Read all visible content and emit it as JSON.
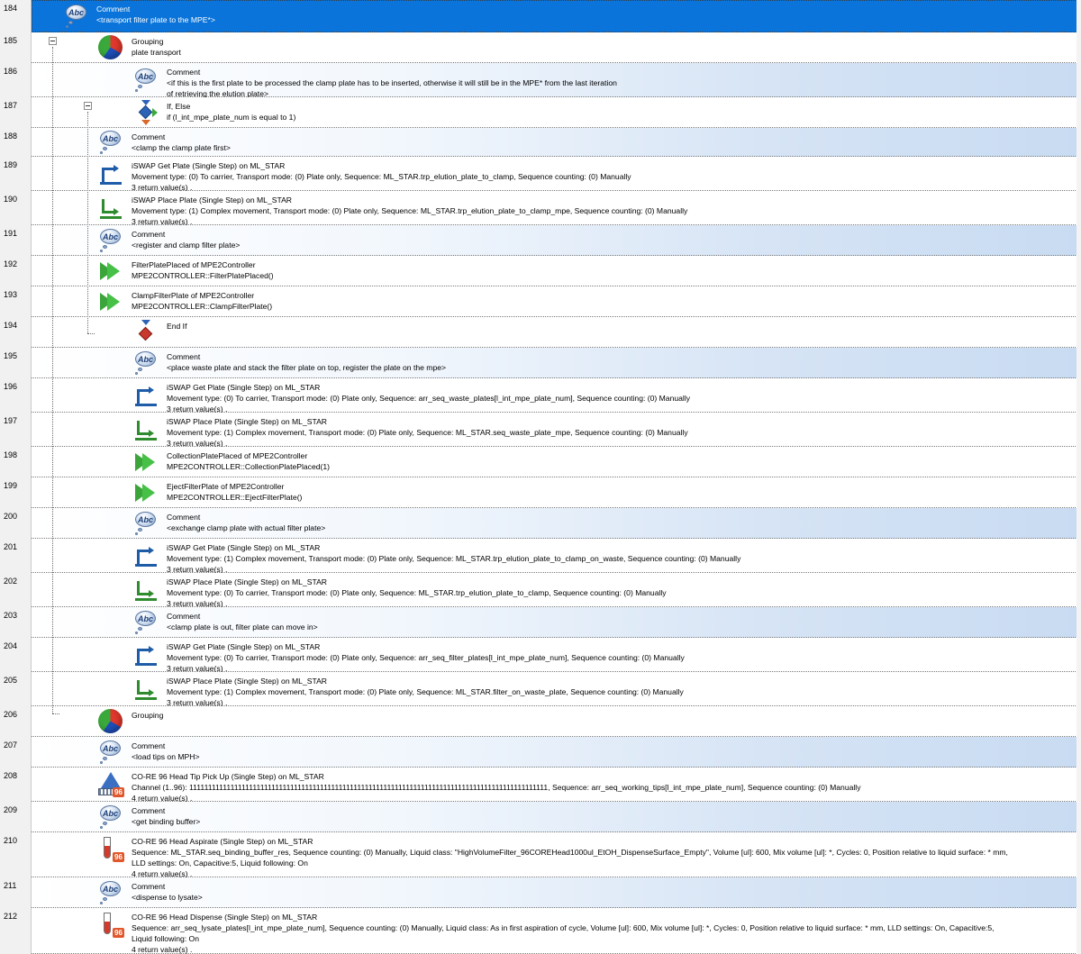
{
  "editor": {
    "rows": [
      {
        "num": "184",
        "kind": "comment",
        "icon": "comment-icon",
        "lines": [
          "Comment",
          "<transport filter plate to the MPE*>"
        ],
        "selected": true
      },
      {
        "num": "185",
        "kind": "group",
        "icon": "grouping-icon",
        "lines": [
          "Grouping",
          "plate transport"
        ]
      },
      {
        "num": "186",
        "kind": "comment",
        "icon": "comment-icon",
        "lines": [
          "Comment",
          "<if this is the first plate to be processed the clamp plate has to be inserted, otherwise it will still be in the MPE* from the last iteration",
          "of retrieving the elution plate>"
        ]
      },
      {
        "num": "187",
        "kind": "if",
        "icon": "if-else-icon",
        "lines": [
          "If, Else",
          "if (l_int_mpe_plate_num is equal to 1)"
        ]
      },
      {
        "num": "188",
        "kind": "comment",
        "icon": "comment-icon",
        "lines": [
          "Comment",
          "<clamp the clamp plate first>"
        ]
      },
      {
        "num": "189",
        "kind": "get",
        "icon": "iswap-get-plate-icon",
        "lines": [
          "iSWAP Get Plate (Single Step) on ML_STAR",
          "Movement type: (0) To carrier, Transport mode: (0) Plate only, Sequence: ML_STAR.trp_elution_plate_to_clamp, Sequence counting: (0) Manually",
          "3 return value(s) ."
        ]
      },
      {
        "num": "190",
        "kind": "place",
        "icon": "iswap-place-plate-icon",
        "lines": [
          "iSWAP Place Plate (Single Step) on ML_STAR",
          "Movement type: (1) Complex movement, Transport mode: (0) Plate only, Sequence: ML_STAR.trp_elution_plate_to_clamp_mpe, Sequence counting: (0) Manually",
          "3 return value(s) ."
        ]
      },
      {
        "num": "191",
        "kind": "comment",
        "icon": "comment-icon",
        "lines": [
          "Comment",
          "<register and clamp filter plate>"
        ]
      },
      {
        "num": "192",
        "kind": "play",
        "icon": "library-call-icon",
        "lines": [
          "FilterPlatePlaced of MPE2Controller",
          "MPE2CONTROLLER::FilterPlatePlaced()"
        ]
      },
      {
        "num": "193",
        "kind": "play",
        "icon": "library-call-icon",
        "lines": [
          "ClampFilterPlate of MPE2Controller",
          "MPE2CONTROLLER::ClampFilterPlate()"
        ]
      },
      {
        "num": "194",
        "kind": "endif",
        "icon": "end-if-icon",
        "lines": [
          "End If"
        ]
      },
      {
        "num": "195",
        "kind": "comment",
        "icon": "comment-icon",
        "lines": [
          "Comment",
          "<place waste plate and stack the filter plate on top, register the plate on the mpe>"
        ]
      },
      {
        "num": "196",
        "kind": "get",
        "icon": "iswap-get-plate-icon",
        "lines": [
          "iSWAP Get Plate (Single Step) on ML_STAR",
          "Movement type: (0) To carrier, Transport mode: (0) Plate only, Sequence: arr_seq_waste_plates[l_int_mpe_plate_num], Sequence counting: (0) Manually",
          "3 return value(s) ."
        ]
      },
      {
        "num": "197",
        "kind": "place",
        "icon": "iswap-place-plate-icon",
        "lines": [
          "iSWAP Place Plate (Single Step) on ML_STAR",
          "Movement type: (1) Complex movement, Transport mode: (0) Plate only, Sequence: ML_STAR.seq_waste_plate_mpe, Sequence counting: (0) Manually",
          "3 return value(s) ."
        ]
      },
      {
        "num": "198",
        "kind": "play",
        "icon": "library-call-icon",
        "lines": [
          "CollectionPlatePlaced of MPE2Controller",
          "MPE2CONTROLLER::CollectionPlatePlaced(1)"
        ]
      },
      {
        "num": "199",
        "kind": "play",
        "icon": "library-call-icon",
        "lines": [
          "EjectFilterPlate of MPE2Controller",
          "MPE2CONTROLLER::EjectFilterPlate()"
        ]
      },
      {
        "num": "200",
        "kind": "comment",
        "icon": "comment-icon",
        "lines": [
          "Comment",
          "<exchange clamp plate with actual filter plate>"
        ]
      },
      {
        "num": "201",
        "kind": "get",
        "icon": "iswap-get-plate-icon",
        "lines": [
          "iSWAP Get Plate (Single Step) on ML_STAR",
          "Movement type: (1) Complex movement, Transport mode: (0) Plate only, Sequence: ML_STAR.trp_elution_plate_to_clamp_on_waste, Sequence counting: (0) Manually",
          "3 return value(s) ."
        ]
      },
      {
        "num": "202",
        "kind": "place",
        "icon": "iswap-place-plate-icon",
        "lines": [
          "iSWAP Place Plate (Single Step) on ML_STAR",
          "Movement type: (0) To carrier, Transport mode: (0) Plate only, Sequence: ML_STAR.trp_elution_plate_to_clamp, Sequence counting: (0) Manually",
          "3 return value(s) ."
        ]
      },
      {
        "num": "203",
        "kind": "comment",
        "icon": "comment-icon",
        "lines": [
          "Comment",
          "<clamp plate is out, filter plate can move in>"
        ]
      },
      {
        "num": "204",
        "kind": "get",
        "icon": "iswap-get-plate-icon",
        "lines": [
          "iSWAP Get Plate (Single Step) on ML_STAR",
          "Movement type: (0) To carrier, Transport mode: (0) Plate only, Sequence: arr_seq_filter_plates[l_int_mpe_plate_num], Sequence counting: (0) Manually",
          "3 return value(s) ."
        ]
      },
      {
        "num": "205",
        "kind": "place",
        "icon": "iswap-place-plate-icon",
        "lines": [
          "iSWAP Place Plate (Single Step) on ML_STAR",
          "Movement type: (1) Complex movement, Transport mode: (0) Plate only, Sequence: ML_STAR.filter_on_waste_plate, Sequence counting: (0) Manually",
          "3 return value(s) ."
        ]
      },
      {
        "num": "206",
        "kind": "group",
        "icon": "grouping-icon",
        "lines": [
          "Grouping"
        ]
      },
      {
        "num": "207",
        "kind": "comment",
        "icon": "comment-icon",
        "lines": [
          "Comment",
          "<load tips on MPH>"
        ]
      },
      {
        "num": "208",
        "kind": "tip",
        "icon": "core96-tip-pickup-icon",
        "badge": "96",
        "lines": [
          "CO-RE 96 Head Tip Pick Up (Single Step) on ML_STAR",
          "Channel (1..96): 111111111111111111111111111111111111111111111111111111111111111111111111111111111111111111111111, Sequence: arr_seq_working_tips[l_int_mpe_plate_num], Sequence counting: (0) Manually",
          "4 return value(s) ."
        ]
      },
      {
        "num": "209",
        "kind": "comment",
        "icon": "comment-icon",
        "lines": [
          "Comment",
          "<get binding buffer>"
        ]
      },
      {
        "num": "210",
        "kind": "tube",
        "icon": "core96-aspirate-icon",
        "badge": "96",
        "lines": [
          "CO-RE 96 Head Aspirate (Single Step) on ML_STAR",
          "Sequence: ML_STAR.seq_binding_buffer_res, Sequence counting: (0) Manually, Liquid class: \"HighVolumeFilter_96COREHead1000ul_EtOH_DispenseSurface_Empty\", Volume [ul]: 600, Mix volume [ul]: *, Cycles: 0, Position relative to liquid surface: * mm,",
          "LLD settings: On, Capacitive:5, Liquid following: On",
          "4 return value(s) ."
        ]
      },
      {
        "num": "211",
        "kind": "comment",
        "icon": "comment-icon",
        "lines": [
          "Comment",
          "<dispense to lysate>"
        ]
      },
      {
        "num": "212",
        "kind": "tube",
        "icon": "core96-dispense-icon",
        "badge": "96",
        "lines": [
          "CO-RE 96 Head Dispense (Single Step) on ML_STAR",
          "Sequence: arr_seq_lysate_plates[l_int_mpe_plate_num], Sequence counting: (0) Manually, Liquid class: As in first aspiration of cycle, Volume [ul]: 600, Mix volume [ul]: *, Cycles: 0, Position relative to liquid surface: * mm, LLD settings: On, Capacitive:5,",
          "Liquid following: On",
          "4 return value(s) ."
        ]
      }
    ]
  }
}
